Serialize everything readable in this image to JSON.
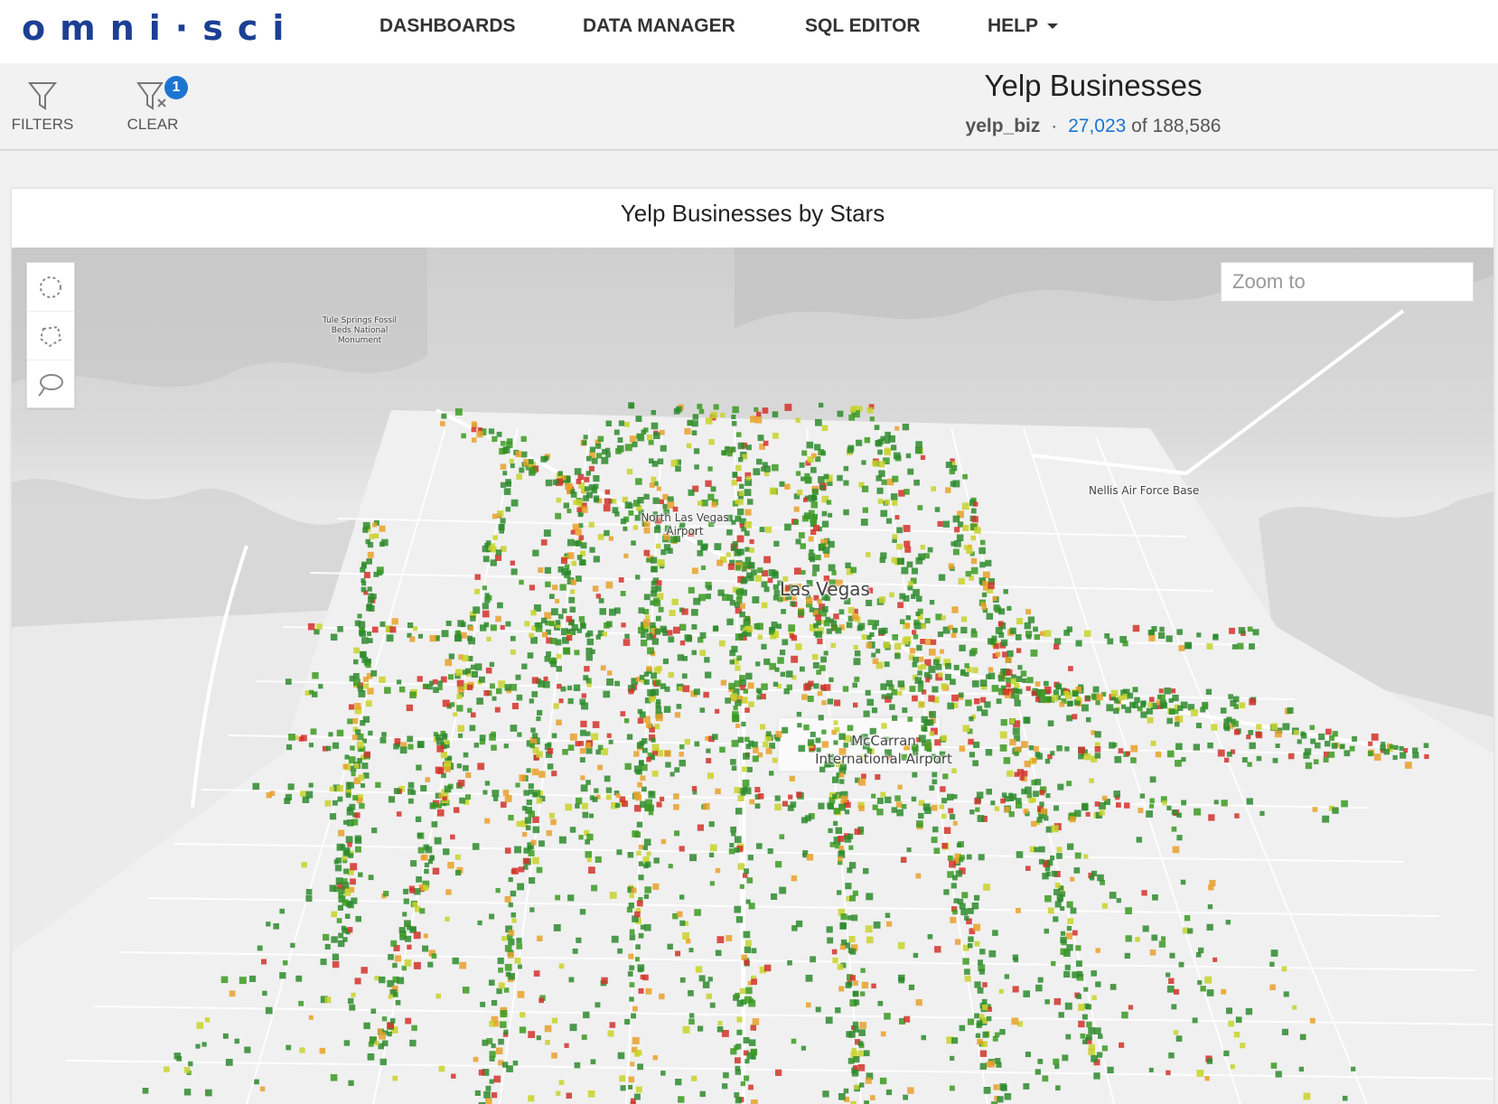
{
  "app": {
    "logo": "omni·sci",
    "nav": {
      "dashboards": "DASHBOARDS",
      "data_manager": "DATA MANAGER",
      "sql_editor": "SQL EDITOR",
      "help": "HELP"
    }
  },
  "toolbar": {
    "filters_label": "FILTERS",
    "clear_label": "CLEAR",
    "active_filter_count": "1"
  },
  "dashboard": {
    "title": "Yelp Businesses",
    "table_name": "yelp_biz",
    "separator": "·",
    "filtered_count": "27,023",
    "of_word": "of",
    "total_count": "188,586"
  },
  "chart": {
    "title": "Yelp Businesses by Stars",
    "zoom_placeholder": "Zoom to",
    "draw_tools": [
      "circle-select-icon",
      "polygon-select-icon",
      "lasso-select-icon"
    ],
    "place_labels": {
      "tule_springs": "Tule Springs Fossil Beds National Monument",
      "north_las_vegas_airport": "North Las Vegas Airport",
      "las_vegas": "Las Vegas",
      "mccarran": "McCarran International Airport",
      "nellis": "Nellis Air Force Base"
    },
    "point_colors": [
      "#2e8b2e",
      "#3c9a22",
      "#c8d22a",
      "#e8a12a",
      "#d2322a"
    ],
    "colors": {
      "brand": "#1c3f94",
      "accent": "#1b75d0",
      "map_background": "#e6e6e6"
    }
  }
}
